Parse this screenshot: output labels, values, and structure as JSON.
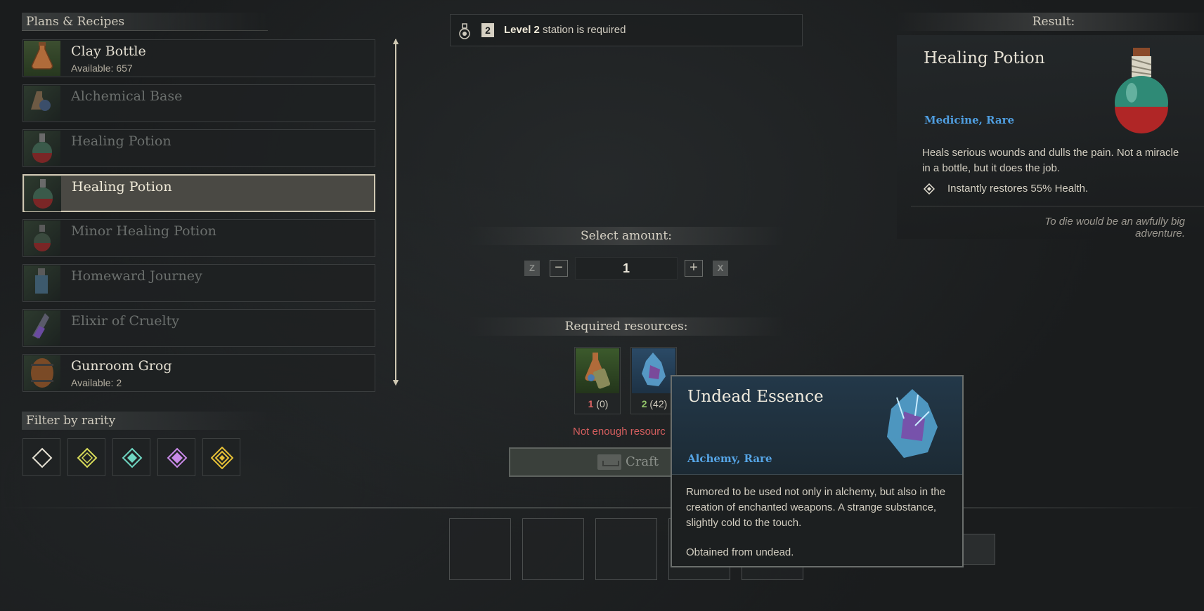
{
  "plans_panel": {
    "title": "Plans & Recipes",
    "items": [
      {
        "name": "Clay Bottle",
        "available": "Available: 657",
        "state": "available",
        "icon": "clay-bottle-icon"
      },
      {
        "name": "Alchemical Base",
        "available": "",
        "state": "unavailable",
        "icon": "alchemical-base-icon"
      },
      {
        "name": "Healing Potion",
        "available": "",
        "state": "unavailable",
        "icon": "healing-potion-icon"
      },
      {
        "name": "Healing Potion",
        "available": "",
        "state": "selected",
        "icon": "healing-potion-icon"
      },
      {
        "name": "Minor Healing Potion",
        "available": "",
        "state": "unavailable",
        "icon": "minor-healing-potion-icon"
      },
      {
        "name": "Homeward Journey",
        "available": "",
        "state": "unavailable",
        "icon": "homeward-journey-icon"
      },
      {
        "name": "Elixir of Cruelty",
        "available": "",
        "state": "unavailable",
        "icon": "elixir-of-cruelty-icon"
      },
      {
        "name": "Gunroom Grog",
        "available": "Available: 2",
        "state": "available",
        "icon": "gunroom-grog-icon"
      }
    ]
  },
  "filter": {
    "title": "Filter by rarity",
    "rarities": [
      {
        "name": "common",
        "color": "#e6e1d4"
      },
      {
        "name": "uncommon",
        "color": "#d9dc5a"
      },
      {
        "name": "rare",
        "color": "#6fd6c2"
      },
      {
        "name": "epic",
        "color": "#c98ae8"
      },
      {
        "name": "legendary",
        "color": "#e6c036"
      }
    ]
  },
  "station": {
    "level_badge": "2",
    "level_text": "Level 2",
    "suffix": " station is required"
  },
  "amount": {
    "title": "Select amount:",
    "value": "1",
    "key_decrease": "Z",
    "key_increase": "X",
    "minus": "−",
    "plus": "+"
  },
  "resources": {
    "title": "Required resources:",
    "items": [
      {
        "icon": "clay-bottle-bundle-icon",
        "need": "1",
        "have": "(0)",
        "status": "insufficient"
      },
      {
        "icon": "undead-essence-icon",
        "need": "2",
        "have": "(42)",
        "status": "sufficient"
      }
    ],
    "warning": "Not enough resourc"
  },
  "craft": {
    "label": "Craft"
  },
  "result": {
    "header": "Result:",
    "title": "Healing Potion",
    "category": "Medicine, Rare",
    "description": "Heals serious wounds and dulls the pain. Not a miracle in a bottle, but it does the job.",
    "effect": "Instantly restores 55% Health.",
    "quote": "To die would be an awfully big adventure."
  },
  "tooltip": {
    "title": "Undead Essence",
    "category": "Alchemy, Rare",
    "description": "Rumored to be used not only in alchemy, but also in the creation of enchanted weapons. A strange substance, slightly cold to the touch.",
    "source": "Obtained from undead."
  }
}
